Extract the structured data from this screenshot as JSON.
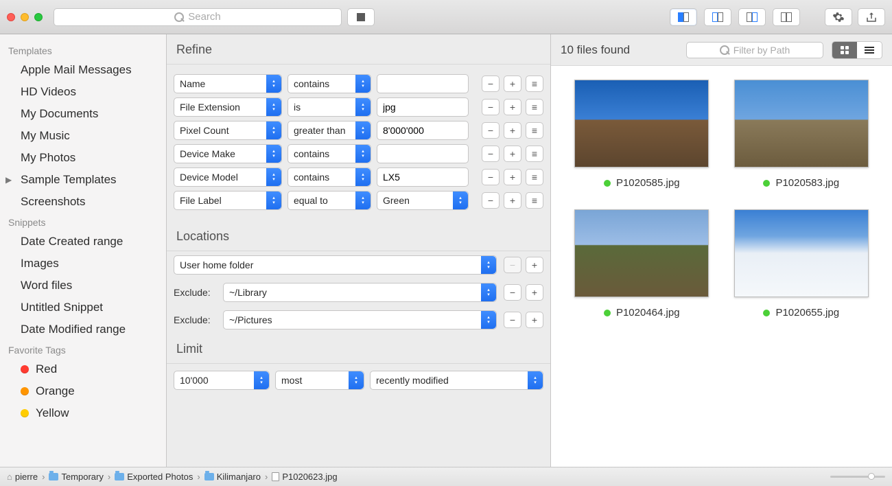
{
  "toolbar": {
    "search_placeholder": "Search"
  },
  "sidebar": {
    "sections": [
      {
        "title": "Templates",
        "items": [
          {
            "label": "Apple Mail Messages"
          },
          {
            "label": "HD Videos"
          },
          {
            "label": "My Documents"
          },
          {
            "label": "My Music"
          },
          {
            "label": "My Photos"
          },
          {
            "label": "Sample Templates",
            "disclosure": true
          },
          {
            "label": "Screenshots"
          }
        ]
      },
      {
        "title": "Snippets",
        "items": [
          {
            "label": "Date Created range"
          },
          {
            "label": "Images"
          },
          {
            "label": "Word files"
          },
          {
            "label": "Untitled Snippet"
          },
          {
            "label": "Date Modified range"
          }
        ]
      },
      {
        "title": "Favorite Tags",
        "items": [
          {
            "label": "Red",
            "color": "#ff3b30"
          },
          {
            "label": "Orange",
            "color": "#ff9500"
          },
          {
            "label": "Yellow",
            "color": "#ffcc00"
          }
        ]
      }
    ]
  },
  "refine": {
    "heading": "Refine",
    "rules": [
      {
        "attr": "Name",
        "op": "contains",
        "val": ""
      },
      {
        "attr": "File Extension",
        "op": "is",
        "val": "jpg"
      },
      {
        "attr": "Pixel Count",
        "op": "greater than",
        "val": "8'000'000"
      },
      {
        "attr": "Device Make",
        "op": "contains",
        "val": ""
      },
      {
        "attr": "Device Model",
        "op": "contains",
        "val": "LX5"
      },
      {
        "attr": "File Label",
        "op": "equal to",
        "val": "Green",
        "val_popup": true
      }
    ],
    "locations_heading": "Locations",
    "location_main": "User home folder",
    "exclude_label": "Exclude:",
    "excludes": [
      "~/Library",
      "~/Pictures"
    ],
    "limit_heading": "Limit",
    "limit": {
      "count": "10'000",
      "sort": "most",
      "by": "recently modified"
    }
  },
  "results": {
    "count_text": "10 files found",
    "filter_placeholder": "Filter by Path",
    "files": [
      {
        "name": "P1020585.jpg",
        "class": "sky"
      },
      {
        "name": "P1020583.jpg",
        "class": "sky2"
      },
      {
        "name": "P1020464.jpg",
        "class": "green"
      },
      {
        "name": "P1020655.jpg",
        "class": "snow"
      }
    ]
  },
  "pathbar": {
    "segments": [
      {
        "icon": "home",
        "label": "pierre"
      },
      {
        "icon": "folder",
        "label": "Temporary"
      },
      {
        "icon": "folder",
        "label": "Exported Photos"
      },
      {
        "icon": "folder",
        "label": "Kilimanjaro"
      },
      {
        "icon": "file",
        "label": "P1020623.jpg"
      }
    ]
  },
  "glyphs": {
    "remove": "−",
    "add": "+",
    "list": "≡",
    "chev": "›"
  }
}
